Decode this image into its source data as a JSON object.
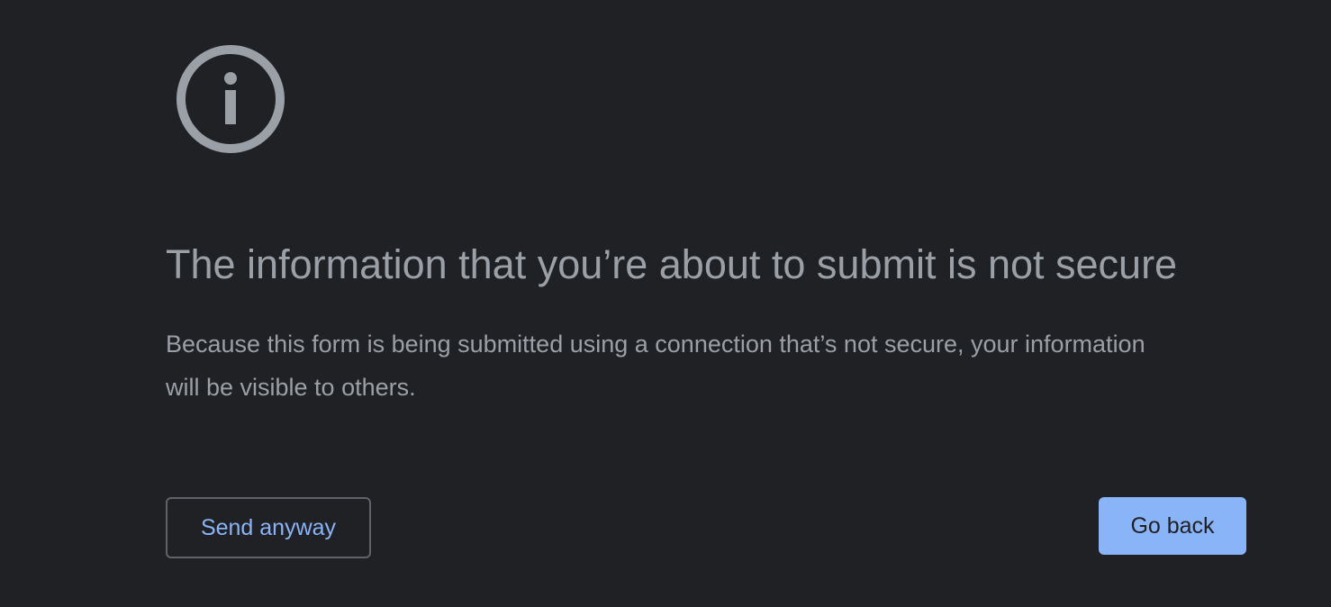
{
  "icon": {
    "name": "info-icon",
    "color": "#9aa0a6"
  },
  "heading": {
    "title": "The information that you’re about to submit is not secure",
    "message": "Because this form is being submitted using a connection that’s not secure, your information will be visible to others."
  },
  "actions": {
    "send_anyway_label": "Send anyway",
    "go_back_label": "Go back"
  },
  "colors": {
    "background": "#202124",
    "text": "#9aa0a6",
    "accent": "#8ab4f8",
    "border": "#5f6368"
  }
}
